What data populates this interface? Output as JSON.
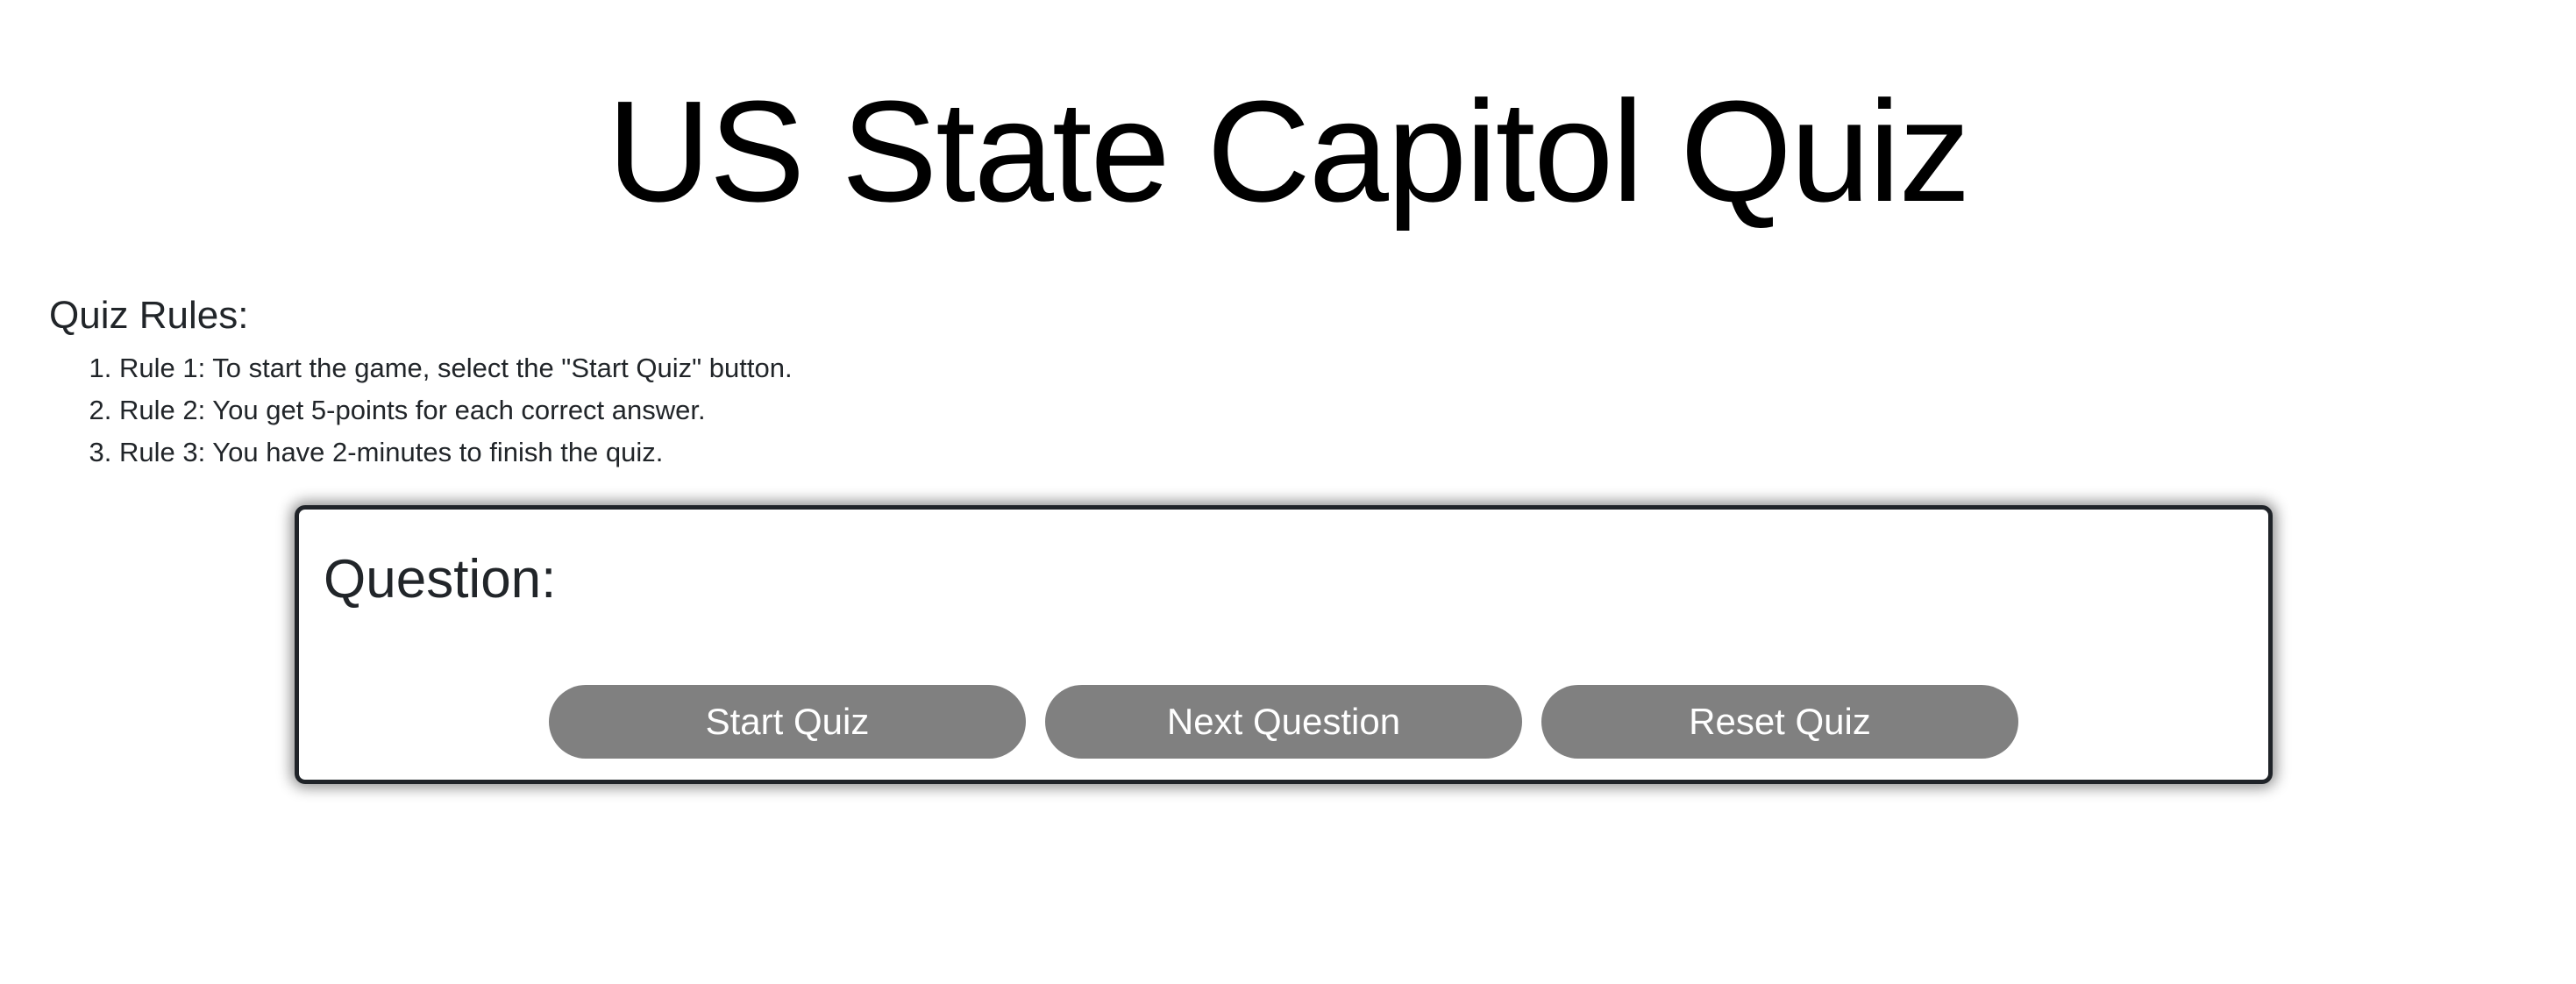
{
  "header": {
    "title": "US State Capitol Quiz"
  },
  "rules": {
    "heading": "Quiz Rules:",
    "items": [
      "Rule 1: To start the game, select the \"Start Quiz\" button.",
      "Rule 2: You get 5-points for each correct answer.",
      "Rule 3: You have 2-minutes to finish the quiz."
    ]
  },
  "quiz": {
    "question_label": "Question:",
    "buttons": {
      "start": "Start Quiz",
      "next": "Next Question",
      "reset": "Reset Quiz"
    }
  },
  "colors": {
    "button_bg": "#808080",
    "button_text": "#ffffff",
    "card_border": "#1f2328",
    "title_text": "#000000"
  }
}
